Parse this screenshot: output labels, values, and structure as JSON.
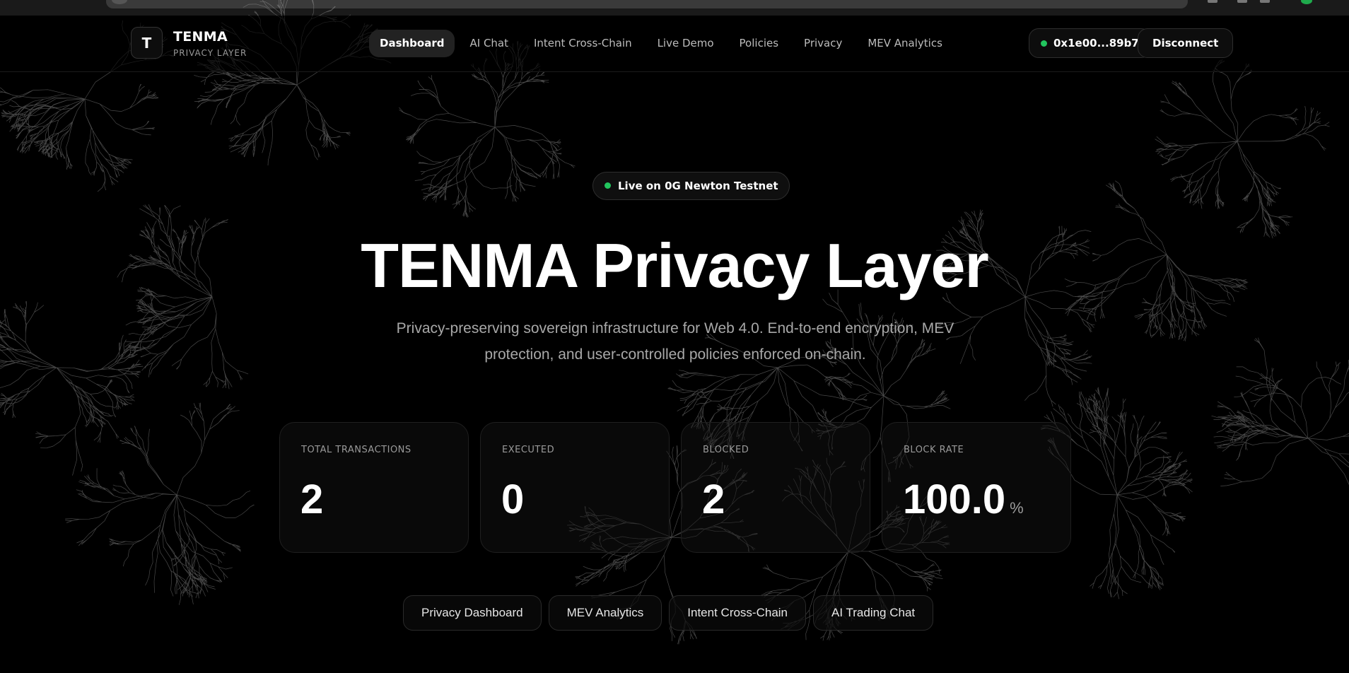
{
  "brand": {
    "logo_letter": "T",
    "name": "TENMA",
    "subtitle": "PRIVACY LAYER"
  },
  "nav": {
    "items": [
      {
        "label": "Dashboard",
        "active": true
      },
      {
        "label": "AI Chat",
        "active": false
      },
      {
        "label": "Intent Cross-Chain",
        "active": false
      },
      {
        "label": "Live Demo",
        "active": false
      },
      {
        "label": "Policies",
        "active": false
      },
      {
        "label": "Privacy",
        "active": false
      },
      {
        "label": "MEV Analytics",
        "active": false
      }
    ]
  },
  "wallet": {
    "address": "0x1e00...89b7",
    "status_color": "#22c55e",
    "disconnect_label": "Disconnect"
  },
  "hero": {
    "status": "Live on 0G Newton Testnet",
    "title": "TENMA Privacy Layer",
    "description": "Privacy-preserving sovereign infrastructure for Web 4.0. End-to-end encryption, MEV protection, and user-controlled policies enforced on-chain."
  },
  "stats": [
    {
      "label": "TOTAL TRANSACTIONS",
      "value": "2",
      "unit": ""
    },
    {
      "label": "EXECUTED",
      "value": "0",
      "unit": ""
    },
    {
      "label": "BLOCKED",
      "value": "2",
      "unit": ""
    },
    {
      "label": "BLOCK RATE",
      "value": "100.0",
      "unit": "%"
    }
  ],
  "quick_links": [
    "Privacy Dashboard",
    "MEV Analytics",
    "Intent Cross-Chain",
    "AI Trading Chat"
  ],
  "colors": {
    "background": "#000000",
    "accent_live": "#22c55e",
    "active_tab": "#222222"
  }
}
